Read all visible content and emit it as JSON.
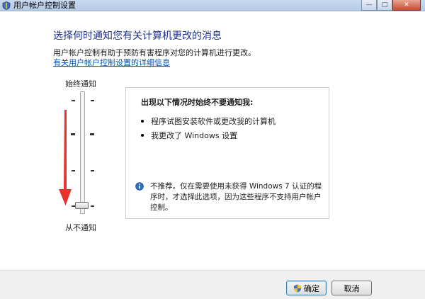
{
  "window": {
    "title": "用户帐户控制设置",
    "controls": {
      "minimize": "—",
      "maximize": "□",
      "close": "✕"
    }
  },
  "main": {
    "heading": "选择何时通知您有关计算机更改的消息",
    "description": "用户帐户控制有助于预防有害程序对您的计算机进行更改。",
    "link": "有关用户帐户控制设置的详细信息"
  },
  "slider": {
    "top_label": "始终通知",
    "bottom_label": "从不通知",
    "levels": 4,
    "selected_level": 1
  },
  "info_box": {
    "title": "出现以下情况时始终不要通知我:",
    "bullets": [
      "程序试图安装软件或更改我的计算机",
      "我更改了 Windows 设置"
    ],
    "note": "不推荐。仅在需要使用未获得 Windows 7 认证的程序时，才选择此选项，因为这些程序不支持用户帐户控制。"
  },
  "buttons": {
    "ok": "确定",
    "cancel": "取消"
  },
  "colors": {
    "heading": "#1e3287",
    "link": "#0b50a8",
    "annotation_arrow": "#e8322c"
  },
  "icons": {
    "ok_button": "uac-shield-icon",
    "note": "info-icon",
    "title": "uac-app-icon"
  }
}
